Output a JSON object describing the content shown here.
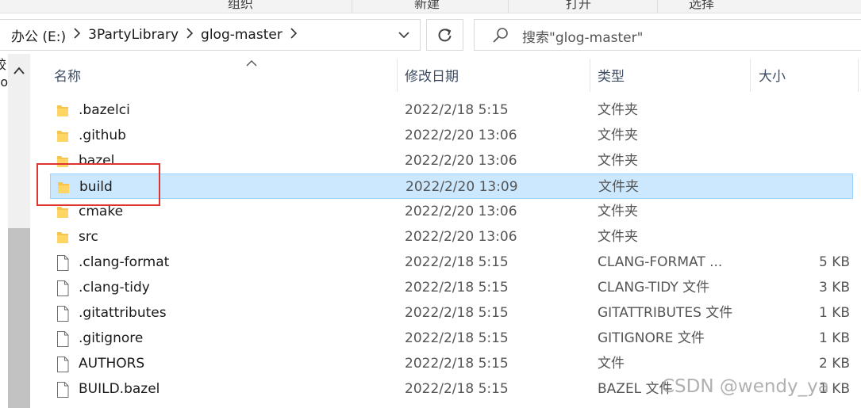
{
  "ribbon": {
    "tabs": [
      "组织",
      "新建",
      "打开",
      "选择"
    ]
  },
  "breadcrumb": [
    "办公 (E:)",
    "3PartyLibrary",
    "glog-master"
  ],
  "search": {
    "placeholder": "搜索\"glog-master\""
  },
  "navpane": {
    "text1": "较",
    "text2": "so"
  },
  "columns": {
    "name": "名称",
    "date": "修改日期",
    "type": "类型",
    "size": "大小"
  },
  "files": [
    {
      "name": ".bazelci",
      "date": "2022/2/18 5:15",
      "type": "文件夹",
      "size": "",
      "kind": "folder"
    },
    {
      "name": ".github",
      "date": "2022/2/20 13:06",
      "type": "文件夹",
      "size": "",
      "kind": "folder"
    },
    {
      "name": "bazel",
      "date": "2022/2/20 13:06",
      "type": "文件夹",
      "size": "",
      "kind": "folder"
    },
    {
      "name": "build",
      "date": "2022/2/20 13:09",
      "type": "文件夹",
      "size": "",
      "kind": "folder",
      "selected": true
    },
    {
      "name": "cmake",
      "date": "2022/2/20 13:06",
      "type": "文件夹",
      "size": "",
      "kind": "folder"
    },
    {
      "name": "src",
      "date": "2022/2/20 13:06",
      "type": "文件夹",
      "size": "",
      "kind": "folder"
    },
    {
      "name": ".clang-format",
      "date": "2022/2/18 5:15",
      "type": "CLANG-FORMAT ...",
      "size": "5 KB",
      "kind": "file"
    },
    {
      "name": ".clang-tidy",
      "date": "2022/2/18 5:15",
      "type": "CLANG-TIDY 文件",
      "size": "3 KB",
      "kind": "file"
    },
    {
      "name": ".gitattributes",
      "date": "2022/2/18 5:15",
      "type": "GITATTRIBUTES 文件",
      "size": "1 KB",
      "kind": "file"
    },
    {
      "name": ".gitignore",
      "date": "2022/2/18 5:15",
      "type": "GITIGNORE 文件",
      "size": "1 KB",
      "kind": "file"
    },
    {
      "name": "AUTHORS",
      "date": "2022/2/18 5:15",
      "type": "文件",
      "size": "2 KB",
      "kind": "file"
    },
    {
      "name": "BUILD.bazel",
      "date": "2022/2/18 5:15",
      "type": "BAZEL 文件",
      "size": "1 KB",
      "kind": "file"
    }
  ],
  "watermark": "CSDN @wendy_ya",
  "colors": {
    "selection": "#cce8ff",
    "selection_border": "#99d1ff",
    "annotation": "#e0322f",
    "folder": "#f8c44d"
  }
}
